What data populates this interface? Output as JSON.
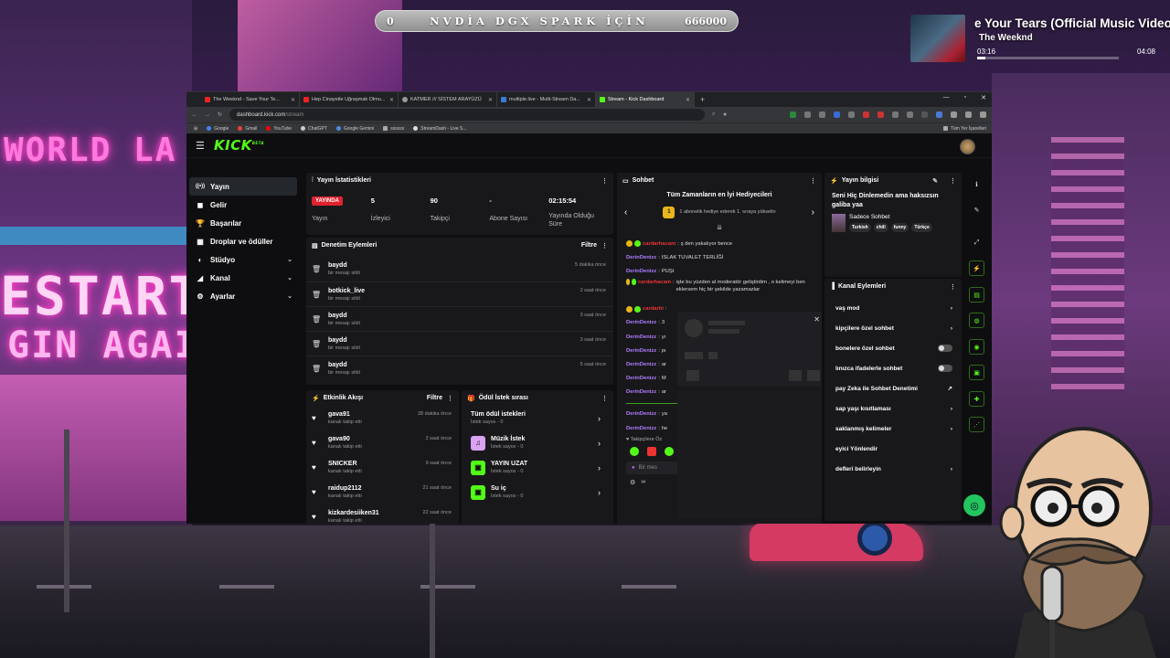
{
  "goal_bar": {
    "start": "0",
    "title": "NVDİA DGX SPARK İÇİN",
    "target": "666000"
  },
  "music": {
    "title": "e Your Tears (Official Music Video)",
    "artist": "The Weeknd",
    "elapsed": "03:16",
    "duration": "04:08",
    "progress": 0.06
  },
  "scene": {
    "neon_1": "WORLD LA",
    "neon_2": "ESTART",
    "neon_3": "GIN AGAIN"
  },
  "browser": {
    "tabs": [
      {
        "label": "The Weeknd - Save Your Te...",
        "color": "#e22"
      },
      {
        "label": "Hep Cinayetle Uğraşmak Olmu...",
        "color": "#e22"
      },
      {
        "label": "KATMER /// SİSTEM ARAYÜZÜ",
        "color": "#999"
      },
      {
        "label": "multiple.live - Multi-Stream Da...",
        "color": "#3a7bd5"
      },
      {
        "label": "Stream - Kick Dashboard",
        "color": "#53fc18"
      }
    ],
    "url_host": "dashboard.kick.com",
    "url_path": "/stream",
    "bookmarks": [
      "Google",
      "Gmail",
      "YouTube",
      "ChatGPT",
      "Google Gemini",
      "ssssss",
      "StreamDash - Live S..."
    ],
    "other_bookmarks": "Tüm Yer İşaretleri"
  },
  "kick": {
    "sidebar": [
      {
        "label": "Yayın",
        "icon": "((•))"
      },
      {
        "label": "Gelir",
        "icon": "◼"
      },
      {
        "label": "Başarılar",
        "icon": "🏆"
      },
      {
        "label": "Droplar ve ödüller",
        "icon": "▦"
      },
      {
        "label": "Stüdyo",
        "icon": "◐"
      },
      {
        "label": "Kanal",
        "icon": "◢"
      },
      {
        "label": "Ayarlar",
        "icon": "⚙"
      }
    ],
    "stats": {
      "title": "Yayın İstatistikleri",
      "live_badge": "YAYINDA",
      "items": [
        {
          "value": "",
          "label": "Yayın"
        },
        {
          "value": "5",
          "label": "İzleyici"
        },
        {
          "value": "90",
          "label": "Takipçi"
        },
        {
          "value": "-",
          "label": "Abone Sayısı"
        },
        {
          "value": "02:15:54",
          "label": "Yayında Olduğu Süre"
        }
      ]
    },
    "moderation": {
      "title": "Denetim Eylemleri",
      "filter": "Filtre",
      "rows": [
        {
          "user": "baydd",
          "action": "bir mesajı sildi",
          "time": "5 dakika önce"
        },
        {
          "user": "botkick_live",
          "action": "bir mesajı sildi",
          "time": "2 saat önce"
        },
        {
          "user": "baydd",
          "action": "bir mesajı sildi",
          "time": "3 saat önce"
        },
        {
          "user": "baydd",
          "action": "bir mesajı sildi",
          "time": "3 saat önce"
        },
        {
          "user": "baydd",
          "action": "bir mesajı sildi",
          "time": "5 saat önce"
        }
      ]
    },
    "activity": {
      "title": "Etkinlik Akışı",
      "filter": "Filtre",
      "rows": [
        {
          "user": "gava91",
          "action": "kanalı takip etti",
          "time": "28 dakika önce"
        },
        {
          "user": "gava90",
          "action": "kanalı takip etti",
          "time": "2 saat önce"
        },
        {
          "user": "SNICKER",
          "action": "kanalı takip etti",
          "time": "9 saat önce"
        },
        {
          "user": "raidup2112",
          "action": "kanalı takip etti",
          "time": "21 saat önce"
        },
        {
          "user": "kizkardesiiken31",
          "action": "kanalı takip etti",
          "time": "22 saat önce"
        }
      ]
    },
    "rewards": {
      "title": "Ödül İstek sırası",
      "rows": [
        {
          "name": "Tüm ödül istekleri",
          "sub": "İstek sayısı - 0",
          "color": ""
        },
        {
          "name": "Müzik İstek",
          "sub": "İstek sayısı - 0",
          "color": "#d9a2f2"
        },
        {
          "name": "YAYIN UZAT",
          "sub": "İstek sayısı - 0",
          "color": "#53fc18"
        },
        {
          "name": "Su iç",
          "sub": "İstek sayısı - 0",
          "color": "#53fc18"
        }
      ]
    },
    "chat": {
      "title": "Sohbet",
      "gifters_title": "Tüm Zamanların en İyi Hediyecileri",
      "gifters_rank": "1",
      "gifters_text": "1 abonelik hediye ederek 1. sıraya yükselin",
      "messages": [
        {
          "user": "cardarhacam",
          "color": "#e33",
          "text": "ş den yakalıyor bence"
        },
        {
          "user": "DerinDenizz",
          "color": "#b27cff",
          "text": "ISLAK TUVALET TERLİĞİ"
        },
        {
          "user": "DerinDenizz",
          "color": "#b27cff",
          "text": "PUŞt"
        },
        {
          "user": "cardarhacam",
          "color": "#e33",
          "text": "işte bu yüzden al moderatör geliştirdim , o kelimeyi ben eklersem hiç bir şekilde yazamazlar"
        },
        {
          "user": "cardarhi",
          "color": "#e33",
          "text": ""
        },
        {
          "user": "DerinDenizz",
          "color": "#b27cff",
          "text": "3"
        },
        {
          "user": "DerinDenizz",
          "color": "#b27cff",
          "text": "yı"
        },
        {
          "user": "DerinDenizz",
          "color": "#b27cff",
          "text": "pı"
        },
        {
          "user": "DerinDenizz",
          "color": "#b27cff",
          "text": "ar"
        },
        {
          "user": "DerinDenizz",
          "color": "#b27cff",
          "text": "M"
        },
        {
          "user": "DerinDenizz",
          "color": "#b27cff",
          "text": "ar"
        },
        {
          "user": "DerinDenizz",
          "color": "#b27cff",
          "text": "ya"
        },
        {
          "user": "DerinDenizz",
          "color": "#b27cff",
          "text": "he"
        }
      ],
      "followers_only": "Takipçilere Öz",
      "input_placeholder": "Bir mes"
    },
    "stream_info": {
      "title": "Yayın bilgisi",
      "stream_title": "Seni Hiç Dinlemedin ama haksızsın galiba yaa",
      "category": "Sadece Sohbet",
      "tags": [
        "Turkish",
        "chill",
        "funny",
        "Türkçe"
      ]
    },
    "channel_actions": {
      "title": "Kanal Eylemleri",
      "rows": [
        {
          "label": "vaş mod",
          "ctrl": "chev"
        },
        {
          "label": "kipçilere özel sohbet",
          "ctrl": "chev"
        },
        {
          "label": "bonelere özel sohbet",
          "ctrl": "toggle"
        },
        {
          "label": "lınızca ifadelerle sohbet",
          "ctrl": "toggle"
        },
        {
          "label": "pay Zeka ile Sohbet Denetimi",
          "ctrl": "link"
        },
        {
          "label": "sap yaşı kısıtlaması",
          "ctrl": "chev"
        },
        {
          "label": "saklanmış kelimeler",
          "ctrl": "chev"
        },
        {
          "label": "eyici Yönlendir",
          "ctrl": ""
        },
        {
          "label": "defleri belirleyin",
          "ctrl": "chev"
        }
      ]
    }
  }
}
